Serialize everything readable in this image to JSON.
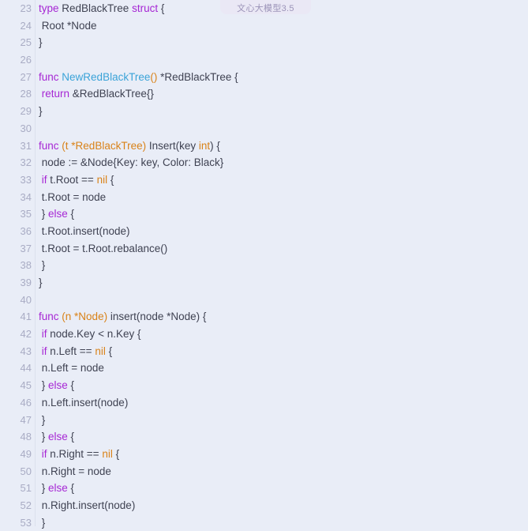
{
  "badge": {
    "label": "文心大模型3.5",
    "background": "#eae8f5",
    "text_color": "#9b93b8"
  },
  "viewer": {
    "background": "#e9edf7",
    "language": "go",
    "first_line": 23,
    "last_line": 53,
    "gutter_color": "#a9acc4",
    "text_color": "#3f4252"
  },
  "palette": {
    "keyword": "#a626d4",
    "function": "#3aa3d8",
    "type": "#d98218",
    "plain": "#3f4252"
  },
  "lines": [
    {
      "n": "23",
      "tokens": [
        {
          "t": "type",
          "c": "k"
        },
        {
          "t": " RedBlackTree ",
          "c": "p"
        },
        {
          "t": "struct",
          "c": "k"
        },
        {
          "t": " {",
          "c": "p"
        }
      ]
    },
    {
      "n": "24",
      "tokens": [
        {
          "t": " Root *Node",
          "c": "p"
        }
      ]
    },
    {
      "n": "25",
      "tokens": [
        {
          "t": "}",
          "c": "p"
        }
      ]
    },
    {
      "n": "26",
      "tokens": []
    },
    {
      "n": "27",
      "tokens": [
        {
          "t": "func",
          "c": "k"
        },
        {
          "t": " ",
          "c": "p"
        },
        {
          "t": "NewRedBlackTree",
          "c": "fn"
        },
        {
          "t": "()",
          "c": "t"
        },
        {
          "t": " *RedBlackTree {",
          "c": "p"
        }
      ]
    },
    {
      "n": "28",
      "tokens": [
        {
          "t": " ",
          "c": "p"
        },
        {
          "t": "return",
          "c": "k"
        },
        {
          "t": " &RedBlackTree{}",
          "c": "p"
        }
      ]
    },
    {
      "n": "29",
      "tokens": [
        {
          "t": "}",
          "c": "p"
        }
      ]
    },
    {
      "n": "30",
      "tokens": []
    },
    {
      "n": "31",
      "tokens": [
        {
          "t": "func",
          "c": "k"
        },
        {
          "t": " ",
          "c": "p"
        },
        {
          "t": "(t *RedBlackTree)",
          "c": "t"
        },
        {
          "t": " Insert(key ",
          "c": "p"
        },
        {
          "t": "int",
          "c": "t"
        },
        {
          "t": ") {",
          "c": "p"
        }
      ]
    },
    {
      "n": "32",
      "tokens": [
        {
          "t": " node := &Node{Key: key, Color: Black}",
          "c": "p"
        }
      ]
    },
    {
      "n": "33",
      "tokens": [
        {
          "t": " ",
          "c": "p"
        },
        {
          "t": "if",
          "c": "k"
        },
        {
          "t": " t.Root == ",
          "c": "p"
        },
        {
          "t": "nil",
          "c": "t"
        },
        {
          "t": " {",
          "c": "p"
        }
      ]
    },
    {
      "n": "34",
      "tokens": [
        {
          "t": " t.Root = node",
          "c": "p"
        }
      ]
    },
    {
      "n": "35",
      "tokens": [
        {
          "t": " } ",
          "c": "p"
        },
        {
          "t": "else",
          "c": "k"
        },
        {
          "t": " {",
          "c": "p"
        }
      ]
    },
    {
      "n": "36",
      "tokens": [
        {
          "t": " t.Root.insert(node)",
          "c": "p"
        }
      ]
    },
    {
      "n": "37",
      "tokens": [
        {
          "t": " t.Root = t.Root.rebalance()",
          "c": "p"
        }
      ]
    },
    {
      "n": "38",
      "tokens": [
        {
          "t": " }",
          "c": "p"
        }
      ]
    },
    {
      "n": "39",
      "tokens": [
        {
          "t": "}",
          "c": "p"
        }
      ]
    },
    {
      "n": "40",
      "tokens": []
    },
    {
      "n": "41",
      "tokens": [
        {
          "t": "func",
          "c": "k"
        },
        {
          "t": " ",
          "c": "p"
        },
        {
          "t": "(n *Node)",
          "c": "t"
        },
        {
          "t": " insert(node *Node) {",
          "c": "p"
        }
      ]
    },
    {
      "n": "42",
      "tokens": [
        {
          "t": " ",
          "c": "p"
        },
        {
          "t": "if",
          "c": "k"
        },
        {
          "t": " node.Key < n.Key {",
          "c": "p"
        }
      ]
    },
    {
      "n": "43",
      "tokens": [
        {
          "t": " ",
          "c": "p"
        },
        {
          "t": "if",
          "c": "k"
        },
        {
          "t": " n.Left == ",
          "c": "p"
        },
        {
          "t": "nil",
          "c": "t"
        },
        {
          "t": " {",
          "c": "p"
        }
      ]
    },
    {
      "n": "44",
      "tokens": [
        {
          "t": " n.Left = node",
          "c": "p"
        }
      ]
    },
    {
      "n": "45",
      "tokens": [
        {
          "t": " } ",
          "c": "p"
        },
        {
          "t": "else",
          "c": "k"
        },
        {
          "t": " {",
          "c": "p"
        }
      ]
    },
    {
      "n": "46",
      "tokens": [
        {
          "t": " n.Left.insert(node)",
          "c": "p"
        }
      ]
    },
    {
      "n": "47",
      "tokens": [
        {
          "t": " }",
          "c": "p"
        }
      ]
    },
    {
      "n": "48",
      "tokens": [
        {
          "t": " } ",
          "c": "p"
        },
        {
          "t": "else",
          "c": "k"
        },
        {
          "t": " {",
          "c": "p"
        }
      ]
    },
    {
      "n": "49",
      "tokens": [
        {
          "t": " ",
          "c": "p"
        },
        {
          "t": "if",
          "c": "k"
        },
        {
          "t": " n.Right == ",
          "c": "p"
        },
        {
          "t": "nil",
          "c": "t"
        },
        {
          "t": " {",
          "c": "p"
        }
      ]
    },
    {
      "n": "50",
      "tokens": [
        {
          "t": " n.Right = node",
          "c": "p"
        }
      ]
    },
    {
      "n": "51",
      "tokens": [
        {
          "t": " } ",
          "c": "p"
        },
        {
          "t": "else",
          "c": "k"
        },
        {
          "t": " {",
          "c": "p"
        }
      ]
    },
    {
      "n": "52",
      "tokens": [
        {
          "t": " n.Right.insert(node)",
          "c": "p"
        }
      ]
    },
    {
      "n": "53",
      "tokens": [
        {
          "t": " }",
          "c": "p"
        }
      ]
    }
  ]
}
